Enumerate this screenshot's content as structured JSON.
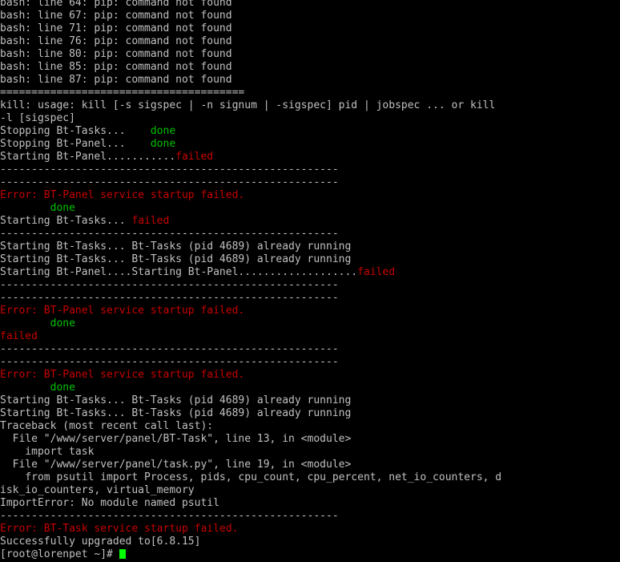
{
  "colors": {
    "background": "#000000",
    "text": "#c0c0c0",
    "error": "#c80000",
    "success": "#00c000",
    "cursor": "#00ff00"
  },
  "terminal": {
    "lines": [
      [
        {
          "t": "bash: line 64: pip: command not found",
          "c": "gray"
        }
      ],
      [
        {
          "t": "bash: line 67: pip: command not found",
          "c": "gray"
        }
      ],
      [
        {
          "t": "bash: line 71: pip: command not found",
          "c": "gray"
        }
      ],
      [
        {
          "t": "bash: line 76: pip: command not found",
          "c": "gray"
        }
      ],
      [
        {
          "t": "bash: line 80: pip: command not found",
          "c": "gray"
        }
      ],
      [
        {
          "t": "bash: line 85: pip: command not found",
          "c": "gray"
        }
      ],
      [
        {
          "t": "bash: line 87: pip: command not found",
          "c": "gray"
        }
      ],
      [
        {
          "t": "=======================================",
          "c": "gray"
        }
      ],
      [
        {
          "t": "kill: usage: kill [-s sigspec | -n signum | -sigspec] pid | jobspec ... or kill",
          "c": "gray"
        }
      ],
      [
        {
          "t": "-l [sigspec]",
          "c": "gray"
        }
      ],
      [
        {
          "t": "Stopping Bt-Tasks...    ",
          "c": "gray"
        },
        {
          "t": "done",
          "c": "green"
        }
      ],
      [
        {
          "t": "Stopping Bt-Panel...    ",
          "c": "gray"
        },
        {
          "t": "done",
          "c": "green"
        }
      ],
      [
        {
          "t": "Starting Bt-Panel...........",
          "c": "gray"
        },
        {
          "t": "failed",
          "c": "red"
        }
      ],
      [
        {
          "t": "------------------------------------------------------",
          "c": "gray"
        }
      ],
      [
        {
          "t": "------------------------------------------------------",
          "c": "gray"
        }
      ],
      [
        {
          "t": "Error: BT-Panel service startup failed.",
          "c": "red"
        }
      ],
      [
        {
          "t": "        ",
          "c": "gray"
        },
        {
          "t": "done",
          "c": "green"
        }
      ],
      [
        {
          "t": "Starting Bt-Tasks... ",
          "c": "gray"
        },
        {
          "t": "failed",
          "c": "red"
        }
      ],
      [
        {
          "t": "------------------------------------------------------",
          "c": "gray"
        }
      ],
      [
        {
          "t": "Starting Bt-Tasks... Bt-Tasks (pid 4689) already running",
          "c": "gray"
        }
      ],
      [
        {
          "t": "Starting Bt-Tasks... Bt-Tasks (pid 4689) already running",
          "c": "gray"
        }
      ],
      [
        {
          "t": "Starting Bt-Panel....Starting Bt-Panel...................",
          "c": "gray"
        },
        {
          "t": "failed",
          "c": "red"
        }
      ],
      [
        {
          "t": "------------------------------------------------------",
          "c": "gray"
        }
      ],
      [
        {
          "t": "------------------------------------------------------",
          "c": "gray"
        }
      ],
      [
        {
          "t": "Error: BT-Panel service startup failed.",
          "c": "red"
        }
      ],
      [
        {
          "t": "        ",
          "c": "gray"
        },
        {
          "t": "done",
          "c": "green"
        }
      ],
      [
        {
          "t": "failed",
          "c": "red"
        }
      ],
      [
        {
          "t": "------------------------------------------------------",
          "c": "gray"
        }
      ],
      [
        {
          "t": "------------------------------------------------------",
          "c": "gray"
        }
      ],
      [
        {
          "t": "Error: BT-Panel service startup failed.",
          "c": "red"
        }
      ],
      [
        {
          "t": "        ",
          "c": "gray"
        },
        {
          "t": "done",
          "c": "green"
        }
      ],
      [
        {
          "t": "Starting Bt-Tasks... Bt-Tasks (pid 4689) already running",
          "c": "gray"
        }
      ],
      [
        {
          "t": "Starting Bt-Tasks... Bt-Tasks (pid 4689) already running",
          "c": "gray"
        }
      ],
      [
        {
          "t": "Traceback (most recent call last):",
          "c": "gray"
        }
      ],
      [
        {
          "t": "  File \"/www/server/panel/BT-Task\", line 13, in <module>",
          "c": "gray"
        }
      ],
      [
        {
          "t": "    import task",
          "c": "gray"
        }
      ],
      [
        {
          "t": "  File \"/www/server/panel/task.py\", line 19, in <module>",
          "c": "gray"
        }
      ],
      [
        {
          "t": "    from psutil import Process, pids, cpu_count, cpu_percent, net_io_counters, d",
          "c": "gray"
        }
      ],
      [
        {
          "t": "isk_io_counters, virtual_memory",
          "c": "gray"
        }
      ],
      [
        {
          "t": "ImportError: No module named psutil",
          "c": "gray"
        }
      ],
      [
        {
          "t": "------------------------------------------------------",
          "c": "gray"
        }
      ],
      [
        {
          "t": "Error: BT-Task service startup failed.",
          "c": "red"
        }
      ],
      [
        {
          "t": "Successfully upgraded to[6.8.15]",
          "c": "gray"
        }
      ]
    ],
    "prompt": "[root@lorenpet ~]# "
  }
}
